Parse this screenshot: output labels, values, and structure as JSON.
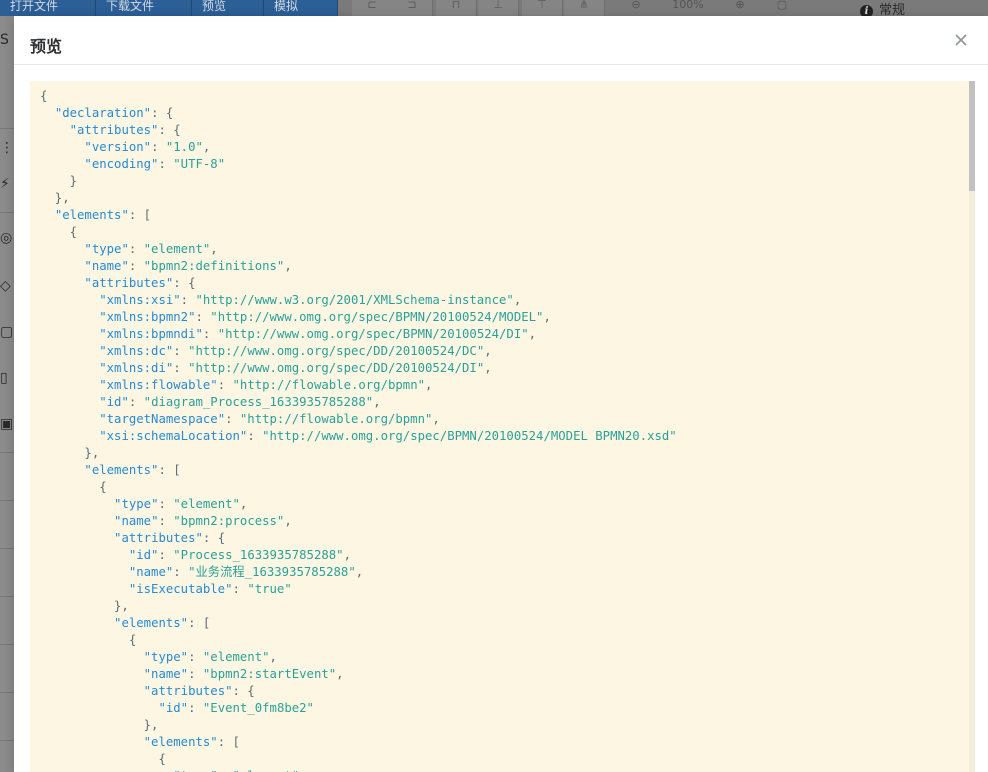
{
  "background": {
    "toolbar_buttons": [
      "打开文件",
      "下载文件",
      "预览",
      "模拟"
    ],
    "zoom_label": "100%",
    "right_panel_tab": "常规"
  },
  "dialog": {
    "title": "预览",
    "close_icon": "close-icon"
  },
  "json_preview": {
    "lines": [
      [
        {
          "t": "{",
          "c": "p"
        }
      ],
      [
        {
          "t": "  ",
          "c": "p"
        },
        {
          "t": "\"declaration\"",
          "c": "k"
        },
        {
          "t": ": {",
          "c": "p"
        }
      ],
      [
        {
          "t": "    ",
          "c": "p"
        },
        {
          "t": "\"attributes\"",
          "c": "k"
        },
        {
          "t": ": {",
          "c": "p"
        }
      ],
      [
        {
          "t": "      ",
          "c": "p"
        },
        {
          "t": "\"version\"",
          "c": "k"
        },
        {
          "t": ": ",
          "c": "p"
        },
        {
          "t": "\"1.0\"",
          "c": "s"
        },
        {
          "t": ",",
          "c": "p"
        }
      ],
      [
        {
          "t": "      ",
          "c": "p"
        },
        {
          "t": "\"encoding\"",
          "c": "k"
        },
        {
          "t": ": ",
          "c": "p"
        },
        {
          "t": "\"UTF-8\"",
          "c": "s"
        }
      ],
      [
        {
          "t": "    }",
          "c": "p"
        }
      ],
      [
        {
          "t": "  },",
          "c": "p"
        }
      ],
      [
        {
          "t": "  ",
          "c": "p"
        },
        {
          "t": "\"elements\"",
          "c": "k"
        },
        {
          "t": ": [",
          "c": "p"
        }
      ],
      [
        {
          "t": "    {",
          "c": "p"
        }
      ],
      [
        {
          "t": "      ",
          "c": "p"
        },
        {
          "t": "\"type\"",
          "c": "k"
        },
        {
          "t": ": ",
          "c": "p"
        },
        {
          "t": "\"element\"",
          "c": "s"
        },
        {
          "t": ",",
          "c": "p"
        }
      ],
      [
        {
          "t": "      ",
          "c": "p"
        },
        {
          "t": "\"name\"",
          "c": "k"
        },
        {
          "t": ": ",
          "c": "p"
        },
        {
          "t": "\"bpmn2:definitions\"",
          "c": "s"
        },
        {
          "t": ",",
          "c": "p"
        }
      ],
      [
        {
          "t": "      ",
          "c": "p"
        },
        {
          "t": "\"attributes\"",
          "c": "k"
        },
        {
          "t": ": {",
          "c": "p"
        }
      ],
      [
        {
          "t": "        ",
          "c": "p"
        },
        {
          "t": "\"xmlns:xsi\"",
          "c": "k"
        },
        {
          "t": ": ",
          "c": "p"
        },
        {
          "t": "\"http://www.w3.org/2001/XMLSchema-instance\"",
          "c": "s"
        },
        {
          "t": ",",
          "c": "p"
        }
      ],
      [
        {
          "t": "        ",
          "c": "p"
        },
        {
          "t": "\"xmlns:bpmn2\"",
          "c": "k"
        },
        {
          "t": ": ",
          "c": "p"
        },
        {
          "t": "\"http://www.omg.org/spec/BPMN/20100524/MODEL\"",
          "c": "s"
        },
        {
          "t": ",",
          "c": "p"
        }
      ],
      [
        {
          "t": "        ",
          "c": "p"
        },
        {
          "t": "\"xmlns:bpmndi\"",
          "c": "k"
        },
        {
          "t": ": ",
          "c": "p"
        },
        {
          "t": "\"http://www.omg.org/spec/BPMN/20100524/DI\"",
          "c": "s"
        },
        {
          "t": ",",
          "c": "p"
        }
      ],
      [
        {
          "t": "        ",
          "c": "p"
        },
        {
          "t": "\"xmlns:dc\"",
          "c": "k"
        },
        {
          "t": ": ",
          "c": "p"
        },
        {
          "t": "\"http://www.omg.org/spec/DD/20100524/DC\"",
          "c": "s"
        },
        {
          "t": ",",
          "c": "p"
        }
      ],
      [
        {
          "t": "        ",
          "c": "p"
        },
        {
          "t": "\"xmlns:di\"",
          "c": "k"
        },
        {
          "t": ": ",
          "c": "p"
        },
        {
          "t": "\"http://www.omg.org/spec/DD/20100524/DI\"",
          "c": "s"
        },
        {
          "t": ",",
          "c": "p"
        }
      ],
      [
        {
          "t": "        ",
          "c": "p"
        },
        {
          "t": "\"xmlns:flowable\"",
          "c": "k"
        },
        {
          "t": ": ",
          "c": "p"
        },
        {
          "t": "\"http://flowable.org/bpmn\"",
          "c": "s"
        },
        {
          "t": ",",
          "c": "p"
        }
      ],
      [
        {
          "t": "        ",
          "c": "p"
        },
        {
          "t": "\"id\"",
          "c": "k"
        },
        {
          "t": ": ",
          "c": "p"
        },
        {
          "t": "\"diagram_Process_1633935785288\"",
          "c": "s"
        },
        {
          "t": ",",
          "c": "p"
        }
      ],
      [
        {
          "t": "        ",
          "c": "p"
        },
        {
          "t": "\"targetNamespace\"",
          "c": "k"
        },
        {
          "t": ": ",
          "c": "p"
        },
        {
          "t": "\"http://flowable.org/bpmn\"",
          "c": "s"
        },
        {
          "t": ",",
          "c": "p"
        }
      ],
      [
        {
          "t": "        ",
          "c": "p"
        },
        {
          "t": "\"xsi:schemaLocation\"",
          "c": "k"
        },
        {
          "t": ": ",
          "c": "p"
        },
        {
          "t": "\"http://www.omg.org/spec/BPMN/20100524/MODEL BPMN20.xsd\"",
          "c": "s"
        }
      ],
      [
        {
          "t": "      },",
          "c": "p"
        }
      ],
      [
        {
          "t": "      ",
          "c": "p"
        },
        {
          "t": "\"elements\"",
          "c": "k"
        },
        {
          "t": ": [",
          "c": "p"
        }
      ],
      [
        {
          "t": "        {",
          "c": "p"
        }
      ],
      [
        {
          "t": "          ",
          "c": "p"
        },
        {
          "t": "\"type\"",
          "c": "k"
        },
        {
          "t": ": ",
          "c": "p"
        },
        {
          "t": "\"element\"",
          "c": "s"
        },
        {
          "t": ",",
          "c": "p"
        }
      ],
      [
        {
          "t": "          ",
          "c": "p"
        },
        {
          "t": "\"name\"",
          "c": "k"
        },
        {
          "t": ": ",
          "c": "p"
        },
        {
          "t": "\"bpmn2:process\"",
          "c": "s"
        },
        {
          "t": ",",
          "c": "p"
        }
      ],
      [
        {
          "t": "          ",
          "c": "p"
        },
        {
          "t": "\"attributes\"",
          "c": "k"
        },
        {
          "t": ": {",
          "c": "p"
        }
      ],
      [
        {
          "t": "            ",
          "c": "p"
        },
        {
          "t": "\"id\"",
          "c": "k"
        },
        {
          "t": ": ",
          "c": "p"
        },
        {
          "t": "\"Process_1633935785288\"",
          "c": "s"
        },
        {
          "t": ",",
          "c": "p"
        }
      ],
      [
        {
          "t": "            ",
          "c": "p"
        },
        {
          "t": "\"name\"",
          "c": "k"
        },
        {
          "t": ": ",
          "c": "p"
        },
        {
          "t": "\"业务流程_1633935785288\"",
          "c": "s"
        },
        {
          "t": ",",
          "c": "p"
        }
      ],
      [
        {
          "t": "            ",
          "c": "p"
        },
        {
          "t": "\"isExecutable\"",
          "c": "k"
        },
        {
          "t": ": ",
          "c": "p"
        },
        {
          "t": "\"true\"",
          "c": "s"
        }
      ],
      [
        {
          "t": "          },",
          "c": "p"
        }
      ],
      [
        {
          "t": "          ",
          "c": "p"
        },
        {
          "t": "\"elements\"",
          "c": "k"
        },
        {
          "t": ": [",
          "c": "p"
        }
      ],
      [
        {
          "t": "            {",
          "c": "p"
        }
      ],
      [
        {
          "t": "              ",
          "c": "p"
        },
        {
          "t": "\"type\"",
          "c": "k"
        },
        {
          "t": ": ",
          "c": "p"
        },
        {
          "t": "\"element\"",
          "c": "s"
        },
        {
          "t": ",",
          "c": "p"
        }
      ],
      [
        {
          "t": "              ",
          "c": "p"
        },
        {
          "t": "\"name\"",
          "c": "k"
        },
        {
          "t": ": ",
          "c": "p"
        },
        {
          "t": "\"bpmn2:startEvent\"",
          "c": "s"
        },
        {
          "t": ",",
          "c": "p"
        }
      ],
      [
        {
          "t": "              ",
          "c": "p"
        },
        {
          "t": "\"attributes\"",
          "c": "k"
        },
        {
          "t": ": {",
          "c": "p"
        }
      ],
      [
        {
          "t": "                ",
          "c": "p"
        },
        {
          "t": "\"id\"",
          "c": "k"
        },
        {
          "t": ": ",
          "c": "p"
        },
        {
          "t": "\"Event_0fm8be2\"",
          "c": "s"
        }
      ],
      [
        {
          "t": "              },",
          "c": "p"
        }
      ],
      [
        {
          "t": "              ",
          "c": "p"
        },
        {
          "t": "\"elements\"",
          "c": "k"
        },
        {
          "t": ": [",
          "c": "p"
        }
      ],
      [
        {
          "t": "                {",
          "c": "p"
        }
      ],
      [
        {
          "t": "                  ",
          "c": "p"
        },
        {
          "t": "\"type\"",
          "c": "k"
        },
        {
          "t": ": ",
          "c": "p"
        },
        {
          "t": "\"element\"",
          "c": "s"
        },
        {
          "t": ",",
          "c": "p"
        }
      ]
    ]
  }
}
